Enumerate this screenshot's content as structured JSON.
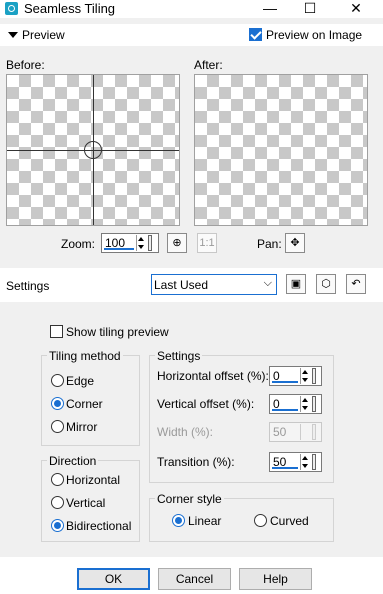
{
  "window": {
    "title": "Seamless Tiling",
    "minimize": "—",
    "maximize": "☐",
    "close": "✕"
  },
  "preview": {
    "label": "Preview",
    "preview_on_image": "Preview on Image",
    "preview_on_image_checked": true,
    "before_label": "Before:",
    "after_label": "After:",
    "zoom_label": "Zoom:",
    "zoom_value": "100",
    "pan_label": "Pan:"
  },
  "settings_bar": {
    "label": "Settings",
    "preset_value": "Last Used"
  },
  "show_tiling_preview": {
    "label": "Show tiling preview",
    "checked": false
  },
  "tiling_method": {
    "title": "Tiling method",
    "options": [
      "Edge",
      "Corner",
      "Mirror"
    ],
    "selected": "Corner"
  },
  "direction": {
    "title": "Direction",
    "options": [
      "Horizontal",
      "Vertical",
      "Bidirectional"
    ],
    "selected": "Bidirectional"
  },
  "settings": {
    "title": "Settings",
    "horizontal_offset_label": "Horizontal offset (%):",
    "horizontal_offset_value": "0",
    "vertical_offset_label": "Vertical offset (%):",
    "vertical_offset_value": "0",
    "width_label": "Width (%):",
    "width_value": "50",
    "transition_label": "Transition (%):",
    "transition_value": "50"
  },
  "corner_style": {
    "title": "Corner style",
    "options": [
      "Linear",
      "Curved"
    ],
    "selected": "Linear"
  },
  "buttons": {
    "ok": "OK",
    "cancel": "Cancel",
    "help": "Help"
  },
  "colors": {
    "accent": "#1a6fd1",
    "checker": "#c8c8c8"
  }
}
